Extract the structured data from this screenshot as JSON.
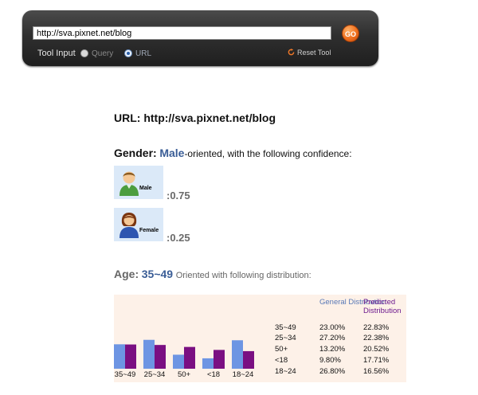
{
  "toolbar": {
    "url_value": "http://sva.pixnet.net/blog",
    "go_label": "GO",
    "tool_input_label": "Tool Input",
    "radio_query_label": "Query",
    "radio_url_label": "URL",
    "selected_mode": "URL",
    "reset_label": "Reset Tool"
  },
  "result": {
    "url_label": "URL:",
    "url_value": "http://sva.pixnet.net/blog",
    "gender": {
      "label": "Gender:",
      "value": "Male",
      "suffix": "-oriented, with the following confidence:",
      "male_label": "Male",
      "male_confidence": ":0.75",
      "female_label": "Female",
      "female_confidence": ":0.25"
    },
    "age": {
      "label": "Age:",
      "value": "35~49",
      "suffix": "Oriented with following distribution:"
    }
  },
  "colors": {
    "general": "#6d95e3",
    "predicted": "#7a0f82",
    "accent": "#3a5d96"
  },
  "chart_data": {
    "type": "bar",
    "categories": [
      "35~49",
      "25~34",
      "50+",
      "<18",
      "18~24"
    ],
    "series": [
      {
        "name": "General Distribution",
        "values": [
          23.0,
          27.2,
          13.2,
          9.8,
          26.8
        ]
      },
      {
        "name": "Predicted Distribution",
        "values": [
          22.83,
          22.38,
          20.52,
          17.71,
          16.56
        ]
      }
    ],
    "ylim": [
      0,
      30
    ]
  },
  "table": {
    "header_general": "General Distribution",
    "header_predicted": "Predicted Distribution",
    "rows": [
      {
        "age": "35~49",
        "general": "23.00%",
        "predicted": "22.83%"
      },
      {
        "age": "25~34",
        "general": "27.20%",
        "predicted": "22.38%"
      },
      {
        "age": "50+",
        "general": "13.20%",
        "predicted": "20.52%"
      },
      {
        "age": "<18",
        "general": "9.80%",
        "predicted": "17.71%"
      },
      {
        "age": "18~24",
        "general": "26.80%",
        "predicted": "16.56%"
      }
    ]
  }
}
